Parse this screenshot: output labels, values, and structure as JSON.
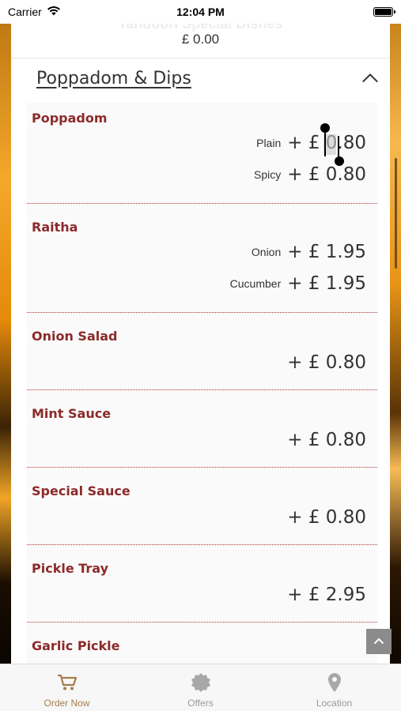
{
  "status_bar": {
    "carrier": "Carrier",
    "time": "12:04 PM"
  },
  "top_card": {
    "hidden_title": "Tandoori Special Dishes",
    "total": "£ 0.00"
  },
  "section": {
    "title": "Poppadom & Dips",
    "icon": "chevron-up-icon"
  },
  "items": [
    {
      "name": "Poppadom",
      "options": [
        {
          "label": "Plain",
          "price": "+ £ 0.80"
        },
        {
          "label": "Spicy",
          "price": "+ £ 0.80"
        }
      ]
    },
    {
      "name": "Raitha",
      "options": [
        {
          "label": "Onion",
          "price": "+ £ 1.95"
        },
        {
          "label": "Cucumber",
          "price": "+ £ 1.95"
        }
      ]
    },
    {
      "name": "Onion Salad",
      "options": [
        {
          "label": "",
          "price": "+ £ 0.80"
        }
      ]
    },
    {
      "name": "Mint Sauce",
      "options": [
        {
          "label": "",
          "price": "+ £ 0.80"
        }
      ]
    },
    {
      "name": "Special Sauce",
      "options": [
        {
          "label": "",
          "price": "+ £ 0.80"
        }
      ]
    },
    {
      "name": "Pickle Tray",
      "options": [
        {
          "label": "",
          "price": "+ £ 2.95"
        }
      ]
    },
    {
      "name": "Garlic Pickle",
      "options": []
    }
  ],
  "tab_bar": {
    "tabs": [
      {
        "label": "Order Now",
        "icon": "cart-icon",
        "active": true
      },
      {
        "label": "Offers",
        "icon": "offers-badge-icon",
        "active": false
      },
      {
        "label": "Location",
        "icon": "location-pin-icon",
        "active": false
      }
    ]
  },
  "colors": {
    "item_name": "#8c2a2a",
    "active_tab": "#a47d4b",
    "inactive_tab": "#9a9a9a"
  }
}
